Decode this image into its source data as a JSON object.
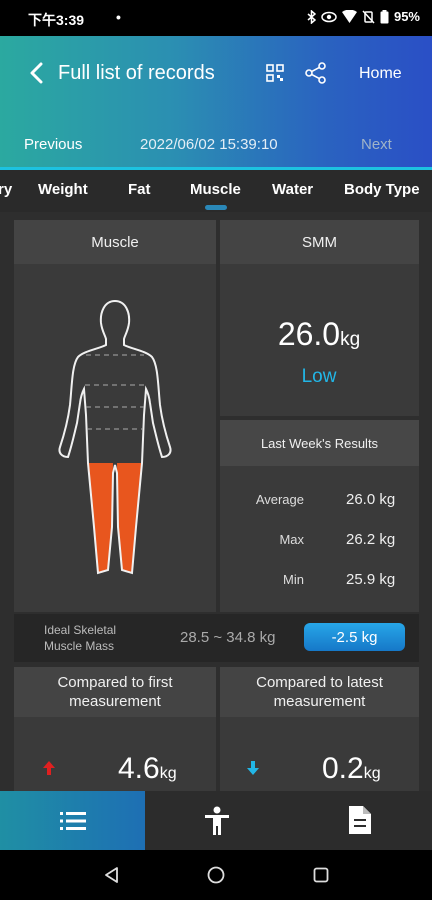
{
  "status_bar": {
    "time": "下午3:39",
    "dot": "•",
    "battery": "95%"
  },
  "header": {
    "title": "Full list of records",
    "home_label": "Home",
    "previous_label": "Previous",
    "datetime": "2022/06/02 15:39:10",
    "next_label": "Next"
  },
  "tabs": {
    "items": [
      "ry",
      "Weight",
      "Fat",
      "Muscle",
      "Water",
      "Body Type"
    ],
    "selected": "Muscle"
  },
  "muscle_card": {
    "title": "Muscle"
  },
  "smm_card": {
    "title": "SMM",
    "value": "26.0",
    "unit": "kg",
    "status": "Low",
    "status_color": "#22b6e6",
    "last_week_title": "Last Week's Results",
    "stats": [
      {
        "label": "Average",
        "value": "26.0 kg"
      },
      {
        "label": "Max",
        "value": "26.2 kg"
      },
      {
        "label": "Min",
        "value": "25.9 kg"
      }
    ]
  },
  "ideal": {
    "label_line1": "Ideal Skeletal",
    "label_line2": "Muscle Mass",
    "range": "28.5 ~ 34.8  kg",
    "difference": "-2.5 kg"
  },
  "compare_first": {
    "title_line1": "Compared to first",
    "title_line2": "measurement",
    "value": "4.6",
    "unit": "kg",
    "direction": "up",
    "arrow_color": "#e02020"
  },
  "compare_latest": {
    "title_line1": "Compared to latest",
    "title_line2": "measurement",
    "value": "0.2",
    "unit": "kg",
    "direction": "down",
    "arrow_color": "#22b6e6"
  },
  "bottom_nav": {
    "items": [
      "list-icon",
      "body-icon",
      "document-icon"
    ],
    "active": "list-icon"
  },
  "colors": {
    "accent": "#1dc2e0",
    "highlight_legs": "#e8561e"
  }
}
